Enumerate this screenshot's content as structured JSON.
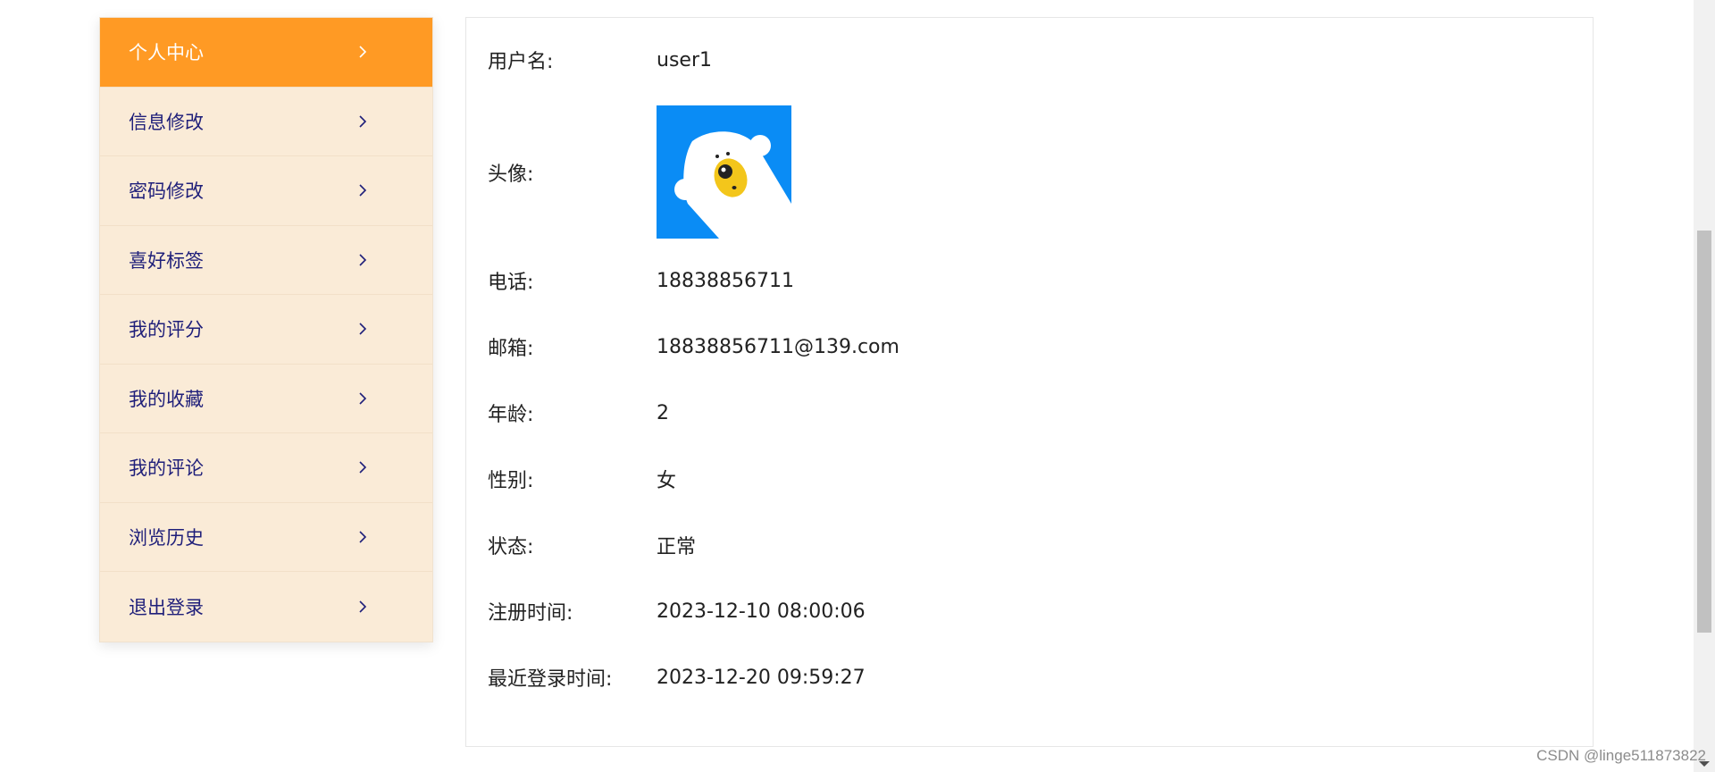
{
  "sidebar": {
    "items": [
      {
        "label": "个人中心",
        "active": true
      },
      {
        "label": "信息修改"
      },
      {
        "label": "密码修改"
      },
      {
        "label": "喜好标签"
      },
      {
        "label": "我的评分"
      },
      {
        "label": "我的收藏"
      },
      {
        "label": "我的评论"
      },
      {
        "label": "浏览历史"
      },
      {
        "label": "退出登录"
      }
    ],
    "active_color": "#ff9a24",
    "bg_color": "#faebd7"
  },
  "profile": {
    "username_label": "用户名:",
    "username_value": "user1",
    "avatar_label": "头像:",
    "phone_label": "电话:",
    "phone_value": "18838856711",
    "email_label": "邮箱:",
    "email_value": "18838856711@139.com",
    "age_label": "年龄:",
    "age_value": "2",
    "gender_label": "性别:",
    "gender_value": "女",
    "status_label": "状态:",
    "status_value": "正常",
    "register_label": "注册时间:",
    "register_value": "2023-12-10 08:00:06",
    "last_login_label": "最近登录时间:",
    "last_login_value": "2023-12-20 09:59:27"
  },
  "watermark": "CSDN @linge511873822"
}
